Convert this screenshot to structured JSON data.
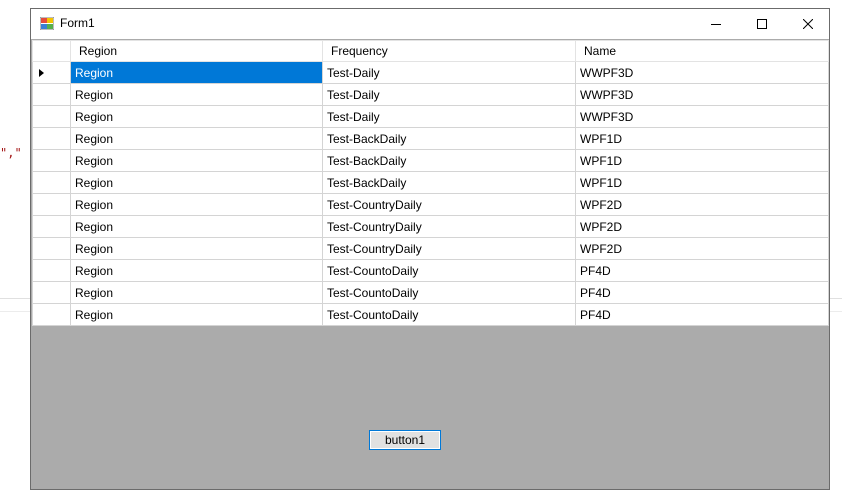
{
  "background": {
    "code_fragment": "\",\""
  },
  "window": {
    "title": "Form1",
    "controls": {
      "minimize": "minimize",
      "maximize": "maximize",
      "close": "close"
    }
  },
  "grid": {
    "columns": [
      "Region",
      "Frequency",
      "Name"
    ],
    "rows": [
      [
        "Region",
        "Test-Daily",
        "WWPF3D"
      ],
      [
        "Region",
        "Test-Daily",
        "WWPF3D"
      ],
      [
        "Region",
        "Test-Daily",
        "WWPF3D"
      ],
      [
        "Region",
        "Test-BackDaily",
        "WPF1D"
      ],
      [
        "Region",
        "Test-BackDaily",
        "WPF1D"
      ],
      [
        "Region",
        "Test-BackDaily",
        "WPF1D"
      ],
      [
        "Region",
        "Test-CountryDaily",
        "WPF2D"
      ],
      [
        "Region",
        "Test-CountryDaily",
        "WPF2D"
      ],
      [
        "Region",
        "Test-CountryDaily",
        "WPF2D"
      ],
      [
        "Region",
        "Test-CountoDaily",
        "PF4D"
      ],
      [
        "Region",
        "Test-CountoDaily",
        "PF4D"
      ],
      [
        "Region",
        "Test-CountoDaily",
        "PF4D"
      ]
    ],
    "selected_row": 0,
    "selected_col": 0
  },
  "button1": {
    "label": "button1"
  },
  "colors": {
    "selection": "#0078d7",
    "client_area": "#ababab",
    "button_border": "#0078d7"
  }
}
